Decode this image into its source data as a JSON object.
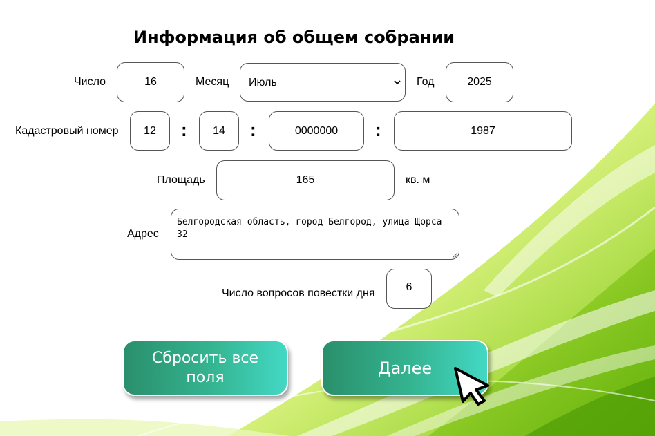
{
  "form": {
    "title": "Информация об общем собрании",
    "day_label": "Число",
    "day_value": "16",
    "month_label": "Месяц",
    "month_value": "Июль",
    "year_label": "Год",
    "year_value": "2025",
    "cadastral_label": "Кадастровый номер",
    "cadastral_part1": "12",
    "cadastral_part2": "14",
    "cadastral_part3": "0000000",
    "cadastral_part4": "1987",
    "separator": ":",
    "area_label": "Площадь",
    "area_value": "165",
    "area_unit": "кв. м",
    "address_label": "Адрес",
    "address_value": "Белгородская область, город Белгород, улица Щорса 32",
    "questions_label": "Число вопросов повестки дня",
    "questions_value": "6"
  },
  "buttons": {
    "reset_label": "Сбросить все поля",
    "next_label": "Далее"
  },
  "colors": {
    "button_gradient_start": "#2a8f6b",
    "button_gradient_end": "#43d8c4",
    "background_green": "#8ed318"
  },
  "icons": {
    "cursor": "mouse-pointer-icon",
    "dropdown": "chevron-down-icon"
  }
}
